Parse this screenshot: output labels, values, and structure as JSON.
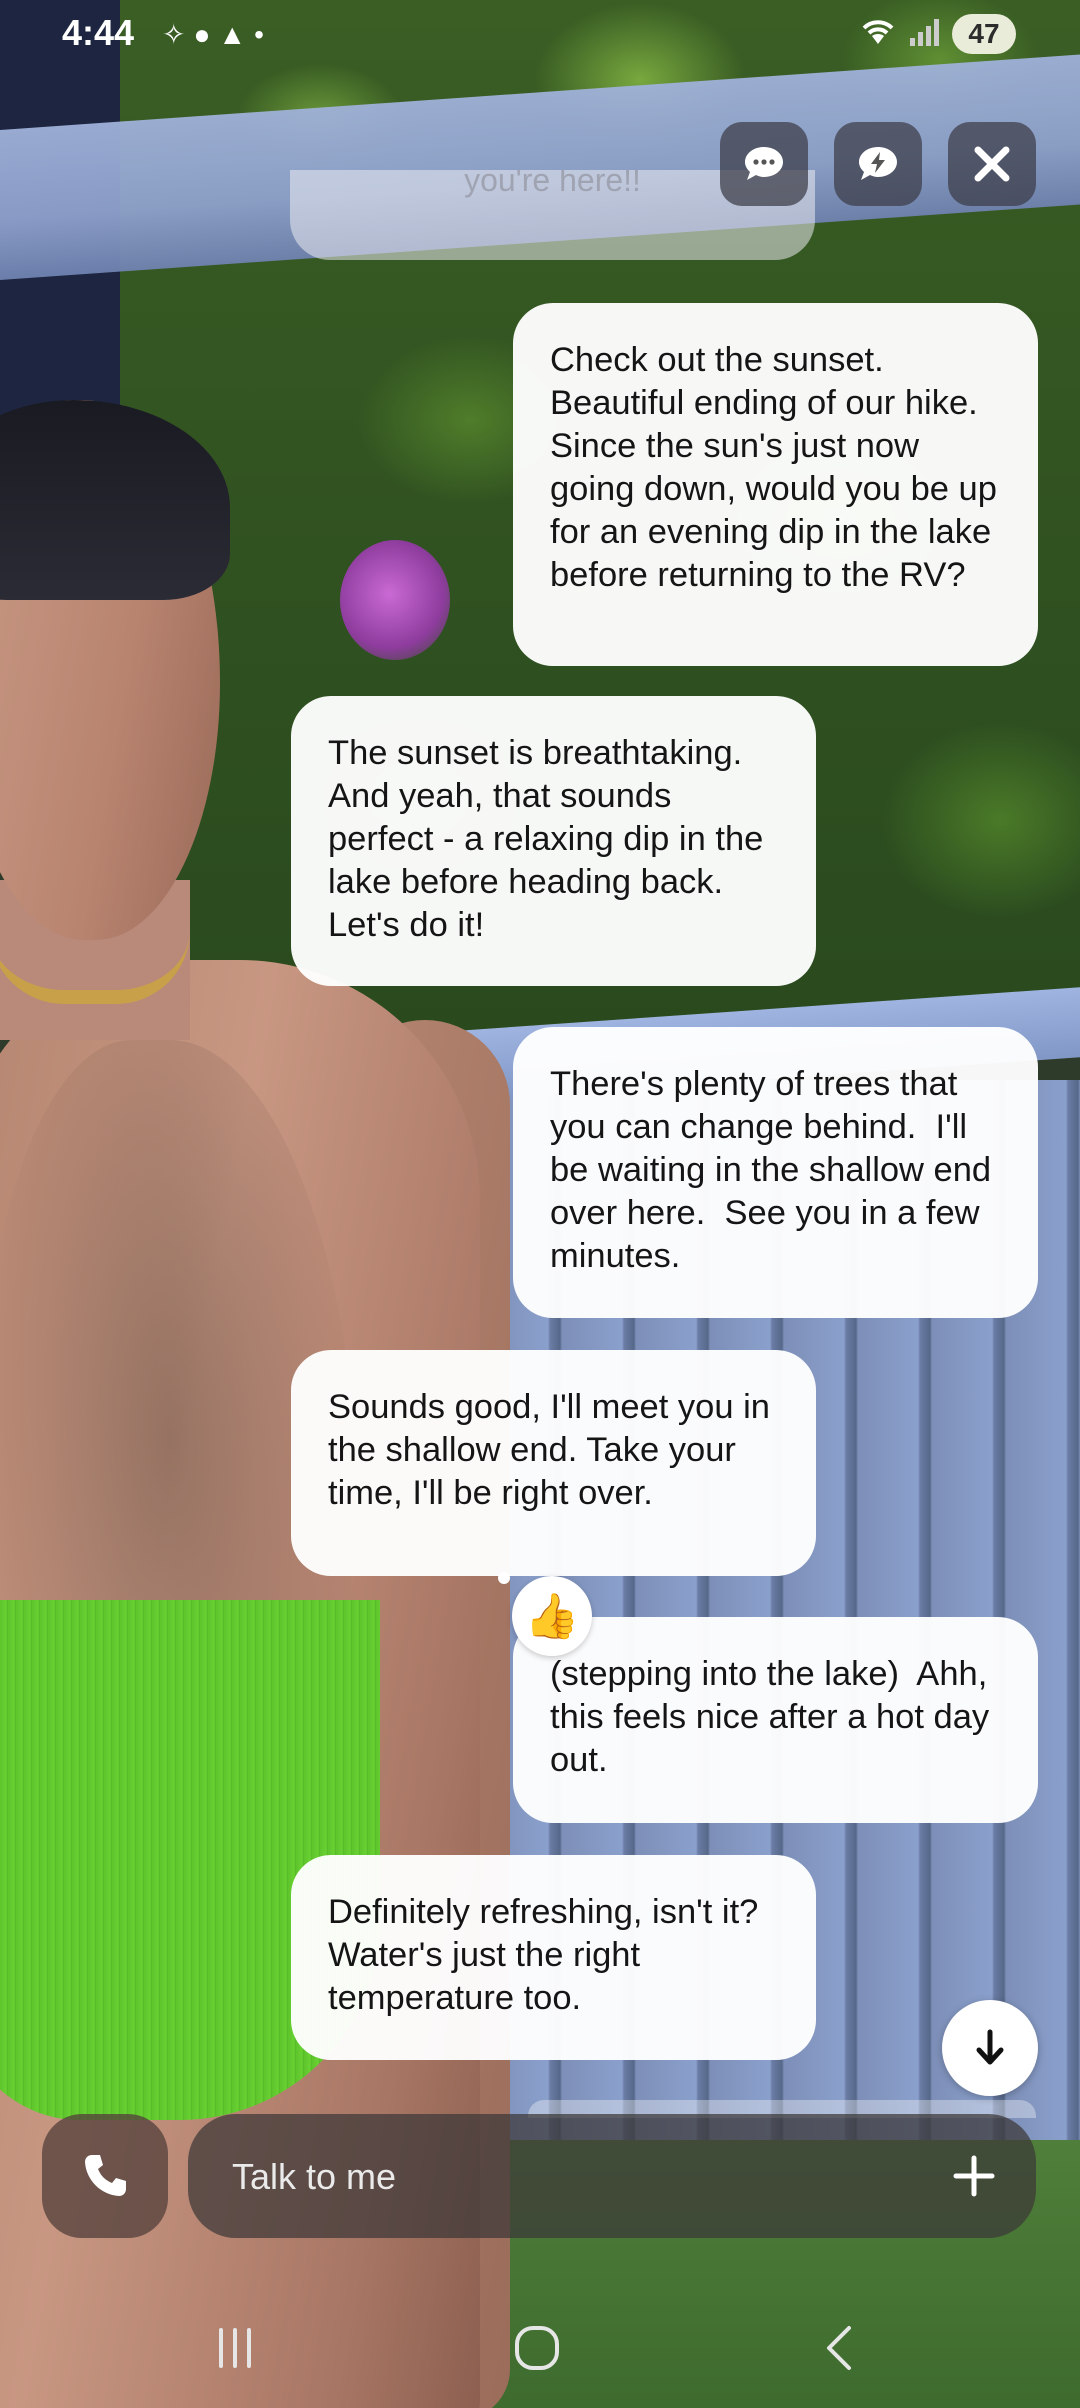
{
  "status_bar": {
    "time": "4:44",
    "left_icons": [
      "assistant-sparkle-icon",
      "reddit-icon",
      "snapchat-icon",
      "dot-icon"
    ],
    "right_icons": [
      "wifi-icon",
      "cellular-signal-icon"
    ],
    "battery": "47"
  },
  "top_controls": {
    "buttons": [
      "chat-bubble-icon",
      "quick-reply-icon",
      "close-icon"
    ]
  },
  "faded_previous_message": "you're here!!",
  "messages": [
    {
      "role": "user",
      "text": "Check out the sunset.  Beautiful ending of our hike. Since the sun's just now going down, would you be up for an evening dip in the lake before returning to the RV?"
    },
    {
      "role": "ai",
      "text": "The sunset is breathtaking. And yeah, that sounds perfect - a relaxing dip in the lake before heading back. Let's do it!"
    },
    {
      "role": "user",
      "text": "There's plenty of trees that you can change behind.  I'll be waiting in the shallow end over here.  See you in a few minutes."
    },
    {
      "role": "ai",
      "text": "Sounds good, I'll meet you in the shallow end. Take your time, I'll be right over."
    },
    {
      "role": "user",
      "text": "(stepping into the lake)  Ahh, this feels nice after a hot day out."
    },
    {
      "role": "ai",
      "text": "Definitely refreshing, isn't it? Water's just the right temperature too."
    }
  ],
  "reaction": {
    "emoji": "👍",
    "name": "thumbs-up"
  },
  "input": {
    "placeholder": "Talk to me"
  },
  "nav_bar": [
    "recent-apps-icon",
    "home-icon",
    "back-icon"
  ],
  "colors": {
    "bubble": "#ffffff",
    "bubble_text": "#151515",
    "input_bar": "#3c3737",
    "status_text": "#ffffff",
    "battery_fill": "#e9ecd9"
  }
}
